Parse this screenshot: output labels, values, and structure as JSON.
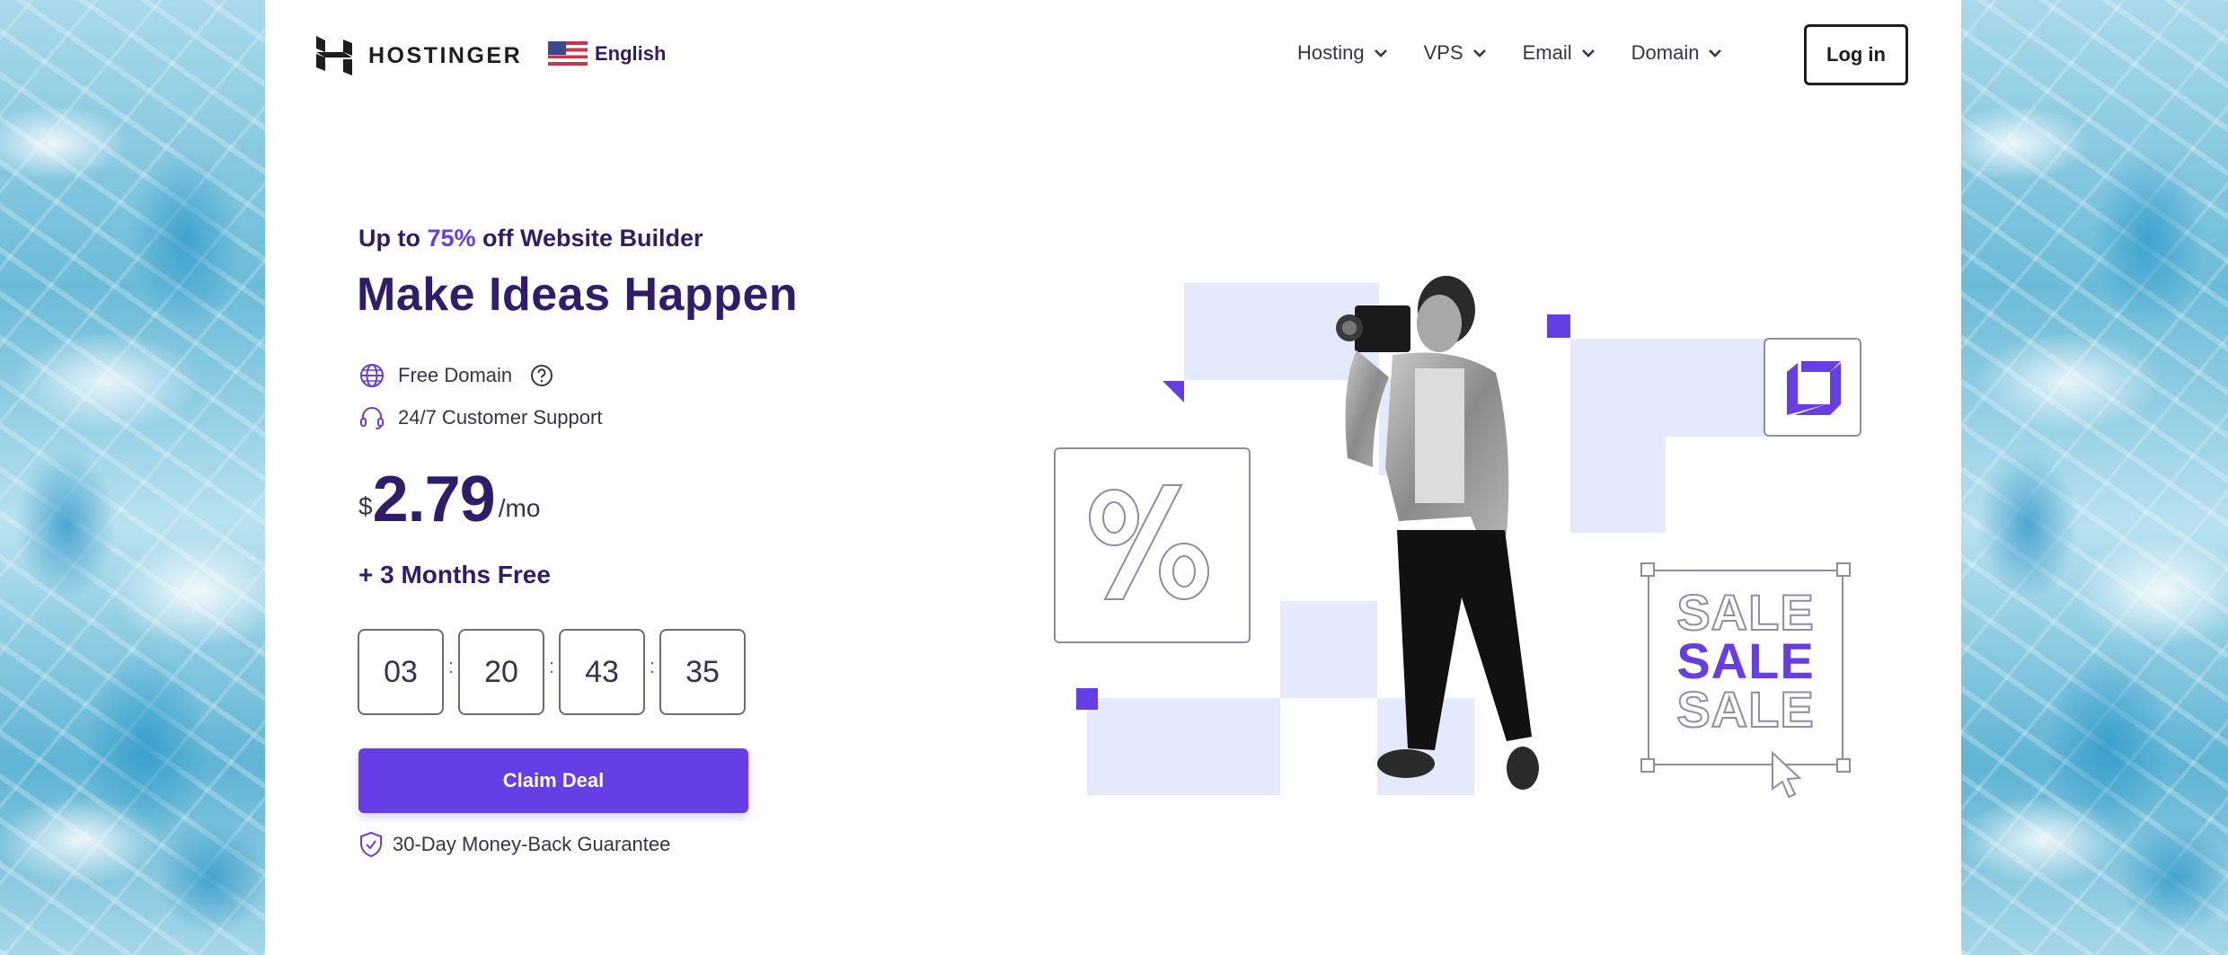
{
  "background": {
    "style": "water-texture"
  },
  "header": {
    "brand": "HOSTINGER",
    "language": {
      "label": "English",
      "flag": "us-flag-icon"
    },
    "nav": [
      {
        "label": "Hosting",
        "icon": "chevron-down-icon"
      },
      {
        "label": "VPS",
        "icon": "chevron-down-icon"
      },
      {
        "label": "Email",
        "icon": "chevron-down-icon"
      },
      {
        "label": "Domain",
        "icon": "chevron-down-icon"
      }
    ],
    "login_label": "Log in"
  },
  "hero": {
    "eyebrow_prefix": "Up to ",
    "eyebrow_accent": "75%",
    "eyebrow_suffix": " off Website Builder",
    "title": "Make Ideas Happen",
    "features": [
      {
        "label": "Free Domain",
        "icon": "globe-icon",
        "help_icon": "question-circle-icon"
      },
      {
        "label": "24/7 Customer Support",
        "icon": "headset-icon"
      }
    ],
    "price": {
      "currency": "$",
      "amount": "2.79",
      "period": "/mo"
    },
    "bonus": "+ 3 Months Free",
    "countdown": {
      "days": "03",
      "hours": "20",
      "minutes": "43",
      "seconds": "35",
      "separator": ":"
    },
    "cta_label": "Claim Deal",
    "guarantee": "30-Day Money-Back Guarantee"
  },
  "illustration": {
    "sale_words": [
      "SALE",
      "SALE",
      "SALE"
    ],
    "percent_symbol": "%",
    "badge_icon": "hostinger-cube-icon",
    "cursor_icon": "pointer-cursor-icon"
  },
  "colors": {
    "brand_purple": "#673de6",
    "heading_navy": "#2f1c6a",
    "text_gray": "#36344d",
    "tint_block": "#e5e9fc"
  }
}
